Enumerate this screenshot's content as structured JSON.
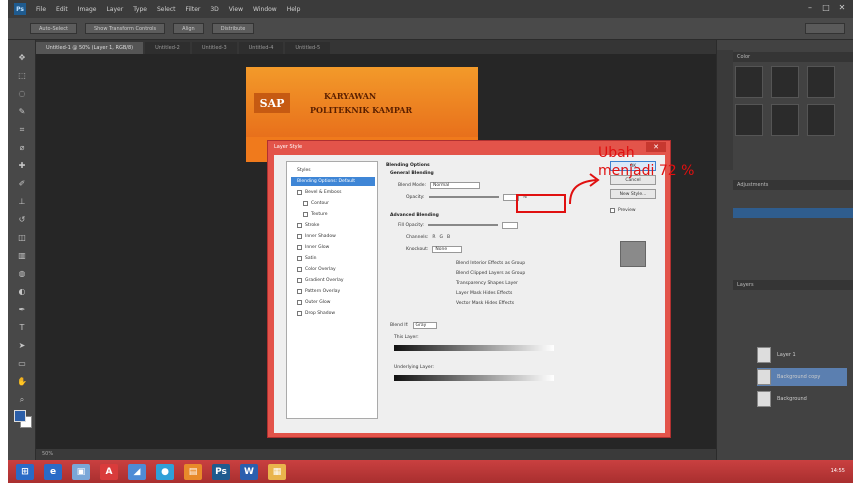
{
  "app": {
    "logo_text": "Ps",
    "menu": [
      "File",
      "Edit",
      "Image",
      "Layer",
      "Type",
      "Select",
      "Filter",
      "3D",
      "View",
      "Window",
      "Help"
    ],
    "option_buttons": [
      "Auto-Select",
      "Show Transform Controls",
      "Align",
      "Distribute"
    ],
    "window_controls": [
      "–",
      "□",
      "✕"
    ]
  },
  "tabs": [
    {
      "label": "Untitled-1 @ 50% (Layer 1, RGB/8)",
      "active": true
    },
    {
      "label": "Untitled-2",
      "active": false
    },
    {
      "label": "Untitled-3",
      "active": false
    },
    {
      "label": "Untitled-4",
      "active": false
    },
    {
      "label": "Untitled-5",
      "active": false
    }
  ],
  "document": {
    "logo_text": "SAP",
    "title_line1": "KARYAWAN",
    "title_line2": "POLITEKNIK KAMPAR",
    "subtitle": ""
  },
  "dialog": {
    "title": "Layer Style",
    "close_label": "✕",
    "styles": [
      {
        "label": "Styles",
        "checkbox": false,
        "selected": false,
        "sub": false
      },
      {
        "label": "Blending Options: Default",
        "checkbox": false,
        "selected": true,
        "sub": false
      },
      {
        "label": "Bevel & Emboss",
        "checkbox": true,
        "selected": false,
        "sub": false
      },
      {
        "label": "Contour",
        "checkbox": true,
        "selected": false,
        "sub": true
      },
      {
        "label": "Texture",
        "checkbox": true,
        "selected": false,
        "sub": true
      },
      {
        "label": "Stroke",
        "checkbox": true,
        "selected": false,
        "sub": false
      },
      {
        "label": "Inner Shadow",
        "checkbox": true,
        "selected": false,
        "sub": false
      },
      {
        "label": "Inner Glow",
        "checkbox": true,
        "selected": false,
        "sub": false
      },
      {
        "label": "Satin",
        "checkbox": true,
        "selected": false,
        "sub": false
      },
      {
        "label": "Color Overlay",
        "checkbox": true,
        "selected": false,
        "sub": false
      },
      {
        "label": "Gradient Overlay",
        "checkbox": true,
        "selected": false,
        "sub": false
      },
      {
        "label": "Pattern Overlay",
        "checkbox": true,
        "selected": false,
        "sub": false
      },
      {
        "label": "Outer Glow",
        "checkbox": true,
        "selected": false,
        "sub": false
      },
      {
        "label": "Drop Shadow",
        "checkbox": true,
        "selected": false,
        "sub": false
      }
    ],
    "blending": {
      "heading": "Blending Options",
      "general": "General Blending",
      "blend_mode_label": "Blend Mode:",
      "blend_mode_value": "Normal",
      "opacity_label": "Opacity:",
      "opacity_value": "",
      "advanced": "Advanced Blending",
      "fill_label": "Fill Opacity:",
      "channels_label": "Channels:",
      "channels": [
        "R",
        "G",
        "B"
      ],
      "knockout_label": "Knockout:",
      "knockout_value": "None",
      "options": [
        "Blend Interior Effects as Group",
        "Blend Clipped Layers as Group",
        "Transparency Shapes Layer",
        "Layer Mask Hides Effects",
        "Vector Mask Hides Effects"
      ],
      "blend_if_label": "Blend If:",
      "blend_if_value": "Gray",
      "this_layer_label": "This Layer:",
      "underlying_label": "Underlying Layer:"
    },
    "buttons": {
      "ok": "OK",
      "cancel": "Cancel",
      "new_style": "New Style...",
      "preview": "Preview"
    }
  },
  "annotation": {
    "line1": "Ubah",
    "line2": "menjadi 72 %",
    "color": "#e01010"
  },
  "right_panel": {
    "header1": "Color",
    "header2": "Adjustments",
    "header3": "Layers",
    "layers": [
      {
        "name": "Layer 1",
        "selected": false
      },
      {
        "name": "Background copy",
        "selected": true
      },
      {
        "name": "Background",
        "selected": false
      }
    ]
  },
  "status": {
    "zoom": "50%"
  },
  "taskbar": {
    "apps": [
      "⊞",
      "e",
      "▣",
      "A",
      "◢",
      "●",
      "▤",
      "Ps",
      "W",
      "▦"
    ],
    "clock": "14:55"
  }
}
